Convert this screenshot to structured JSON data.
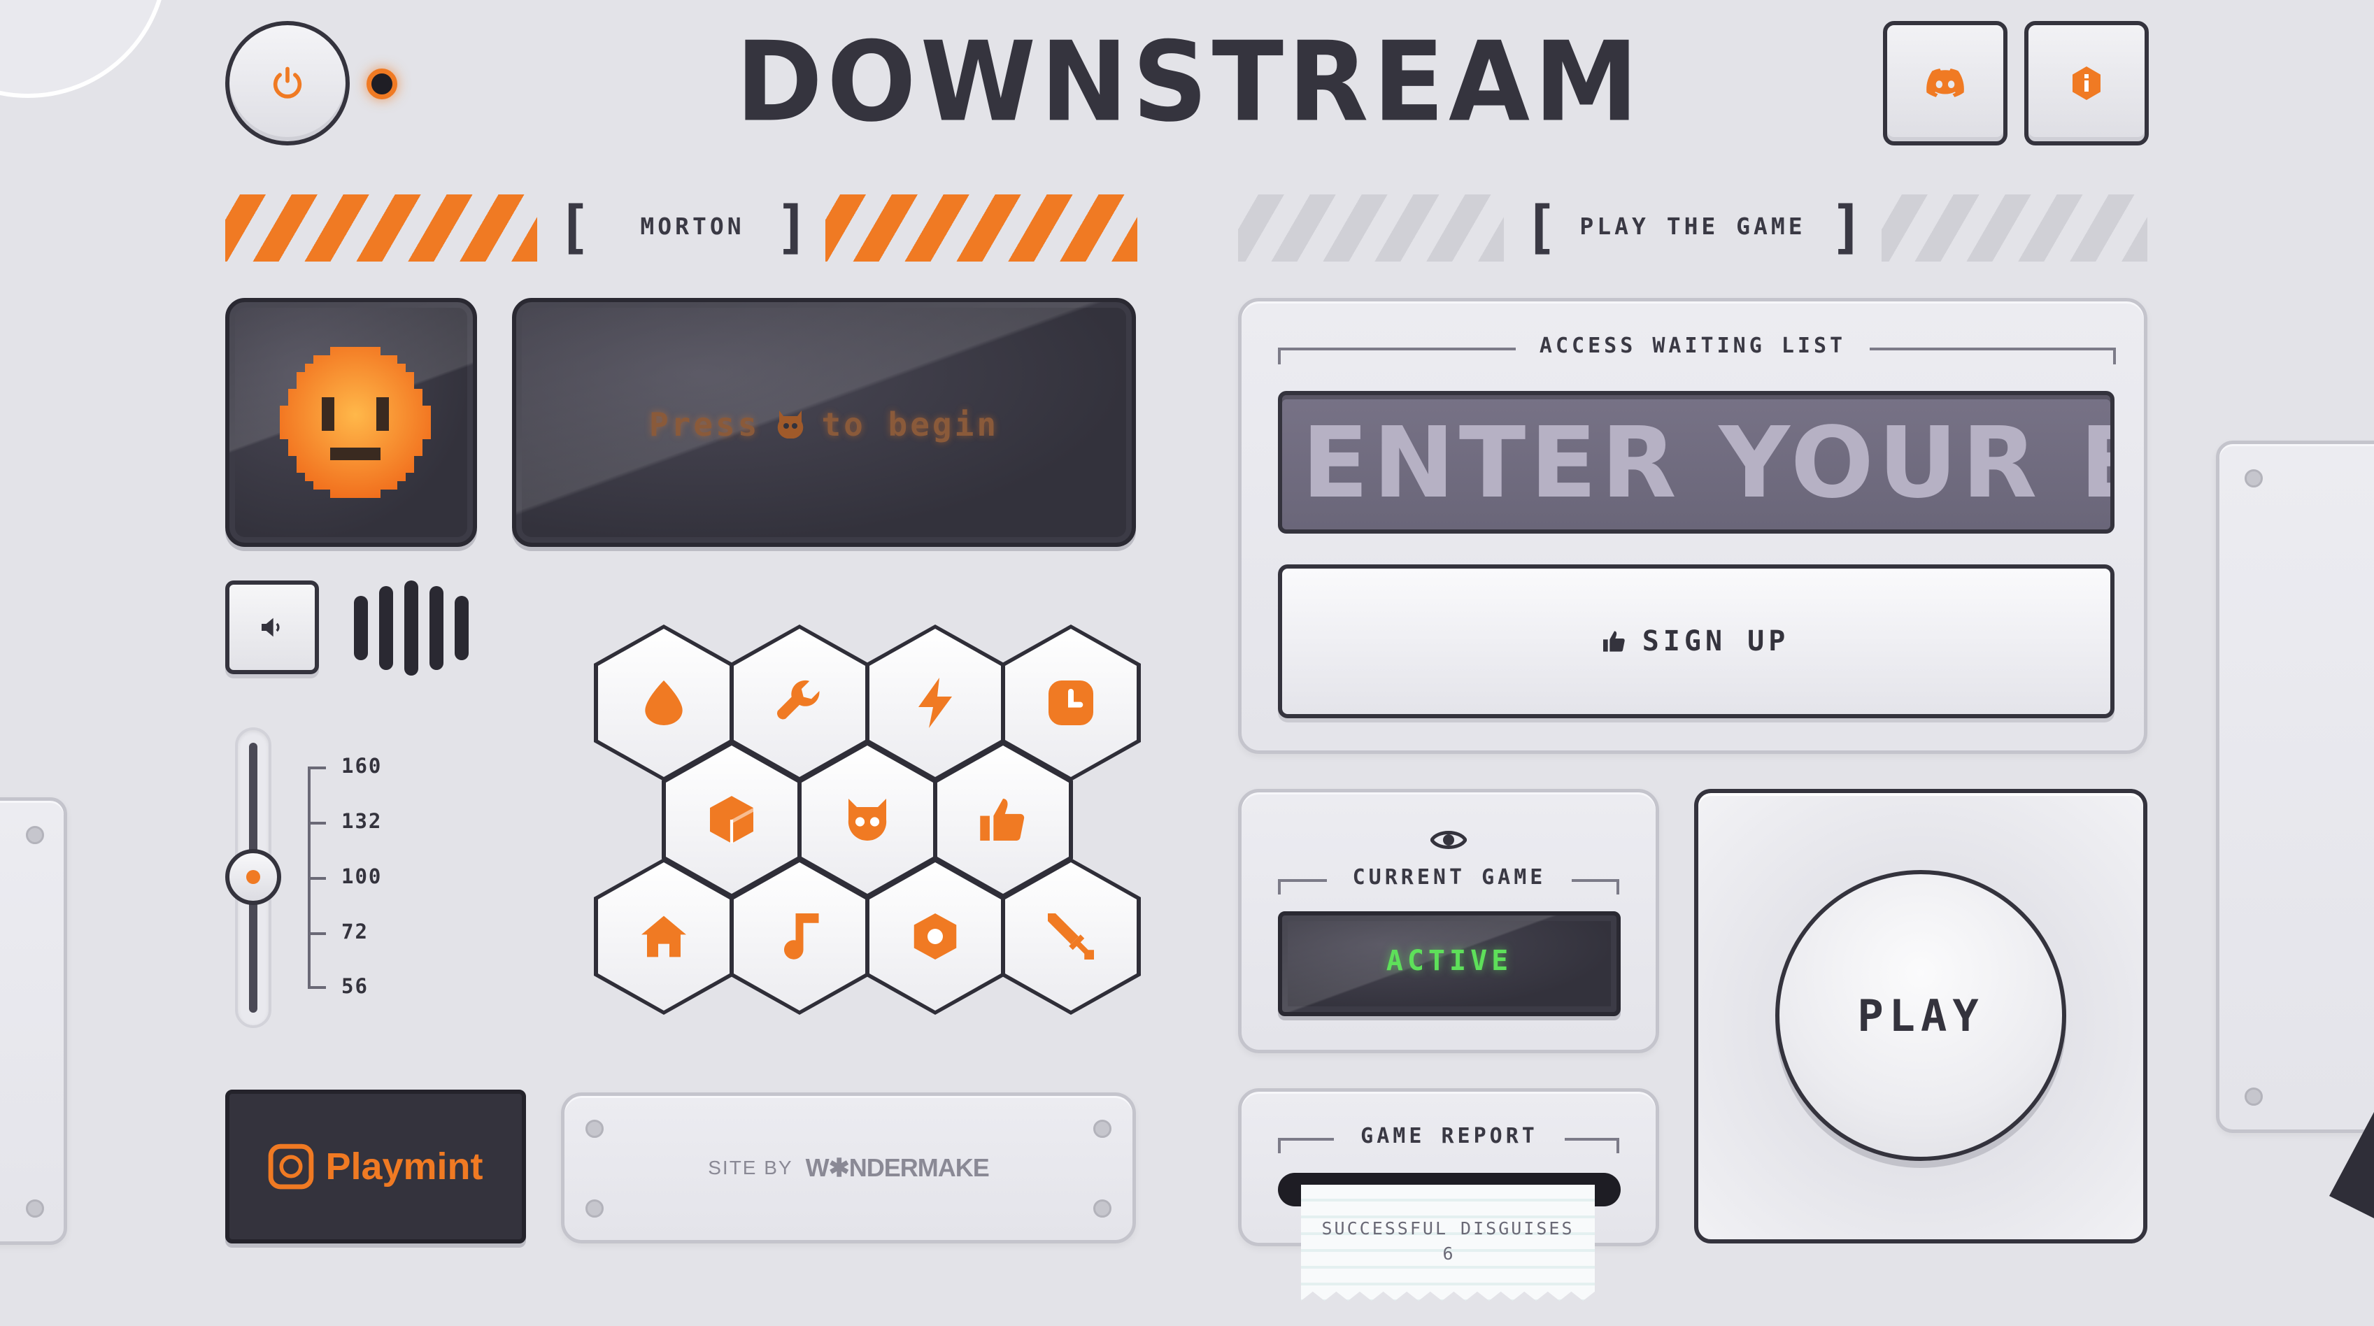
{
  "header": {
    "logo_text": "DOWNSTREAM",
    "power_icon": "power-icon",
    "discord_icon": "discord-icon",
    "info_icon": "info-icon"
  },
  "left_banner": {
    "label": "MORTON"
  },
  "right_banner": {
    "label": "PLAY THE GAME"
  },
  "display": {
    "prompt_before": "Press",
    "prompt_after": "to begin",
    "prompt_icon": "robot-icon",
    "face_icon": "pixel-face-icon"
  },
  "volume": {
    "speaker_icon": "speaker-icon",
    "scale": [
      "160",
      "132",
      "100",
      "72",
      "56"
    ],
    "selected": "100"
  },
  "hex_grid": {
    "row1": [
      "drop-icon",
      "wrench-icon",
      "lightning-icon",
      "clock-icon"
    ],
    "row2": [
      "cube-icon",
      "robot-icon",
      "thumbs-up-icon"
    ],
    "row3": [
      "home-icon",
      "music-note-icon",
      "hexagon-icon",
      "sword-icon"
    ]
  },
  "footer": {
    "playmint_label": "Playmint",
    "site_by_label": "SITE BY",
    "wondermake_label": "W✱NDERMAKE"
  },
  "waitlist": {
    "title": "ACCESS WAITING LIST",
    "email_placeholder": "ENTER YOUR EMAIL",
    "signup_label": "SIGN UP"
  },
  "current_game": {
    "title": "CURRENT GAME",
    "status": "ACTIVE"
  },
  "game_report": {
    "title": "GAME REPORT",
    "receipt_label": "SUCCESSFUL DISGUISES",
    "receipt_value": "6"
  },
  "play_button": {
    "label": "PLAY"
  },
  "colors": {
    "accent": "#f07a23",
    "dark": "#34333d",
    "background": "#e3e3e8",
    "active_green": "#5ee05a"
  }
}
